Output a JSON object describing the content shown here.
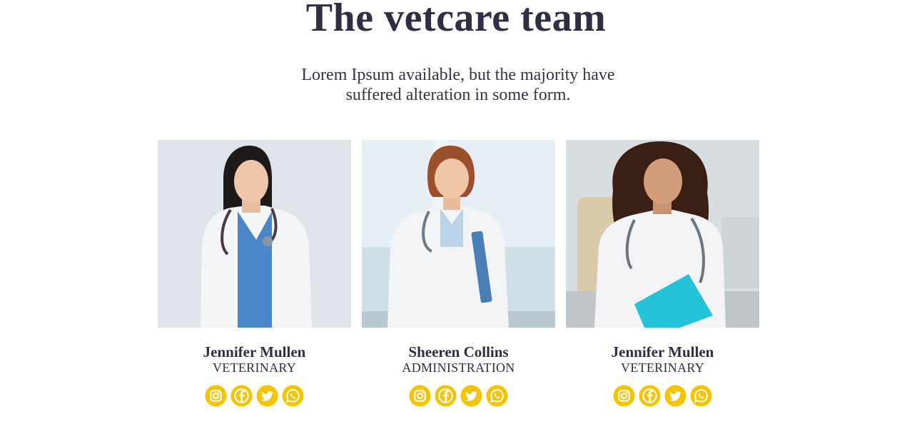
{
  "header": {
    "title": "The vetcare team",
    "subtitle": "Lorem Ipsum available, but the majority have suffered alteration in some form."
  },
  "theme": {
    "text_color": "#2e2e44",
    "icon_color": "#f5c400"
  },
  "team": [
    {
      "name": "Jennifer Mullen",
      "role": "VETERINARY",
      "photo": "doctor-photo",
      "socials": [
        "instagram-icon",
        "facebook-icon",
        "twitter-icon",
        "whatsapp-icon"
      ]
    },
    {
      "name": "Sheeren Collins",
      "role": "ADMINISTRATION",
      "photo": "doctor-photo",
      "socials": [
        "instagram-icon",
        "facebook-icon",
        "twitter-icon",
        "whatsapp-icon"
      ]
    },
    {
      "name": "Jennifer Mullen",
      "role": "VETERINARY",
      "photo": "doctor-photo",
      "socials": [
        "instagram-icon",
        "facebook-icon",
        "twitter-icon",
        "whatsapp-icon"
      ]
    }
  ]
}
